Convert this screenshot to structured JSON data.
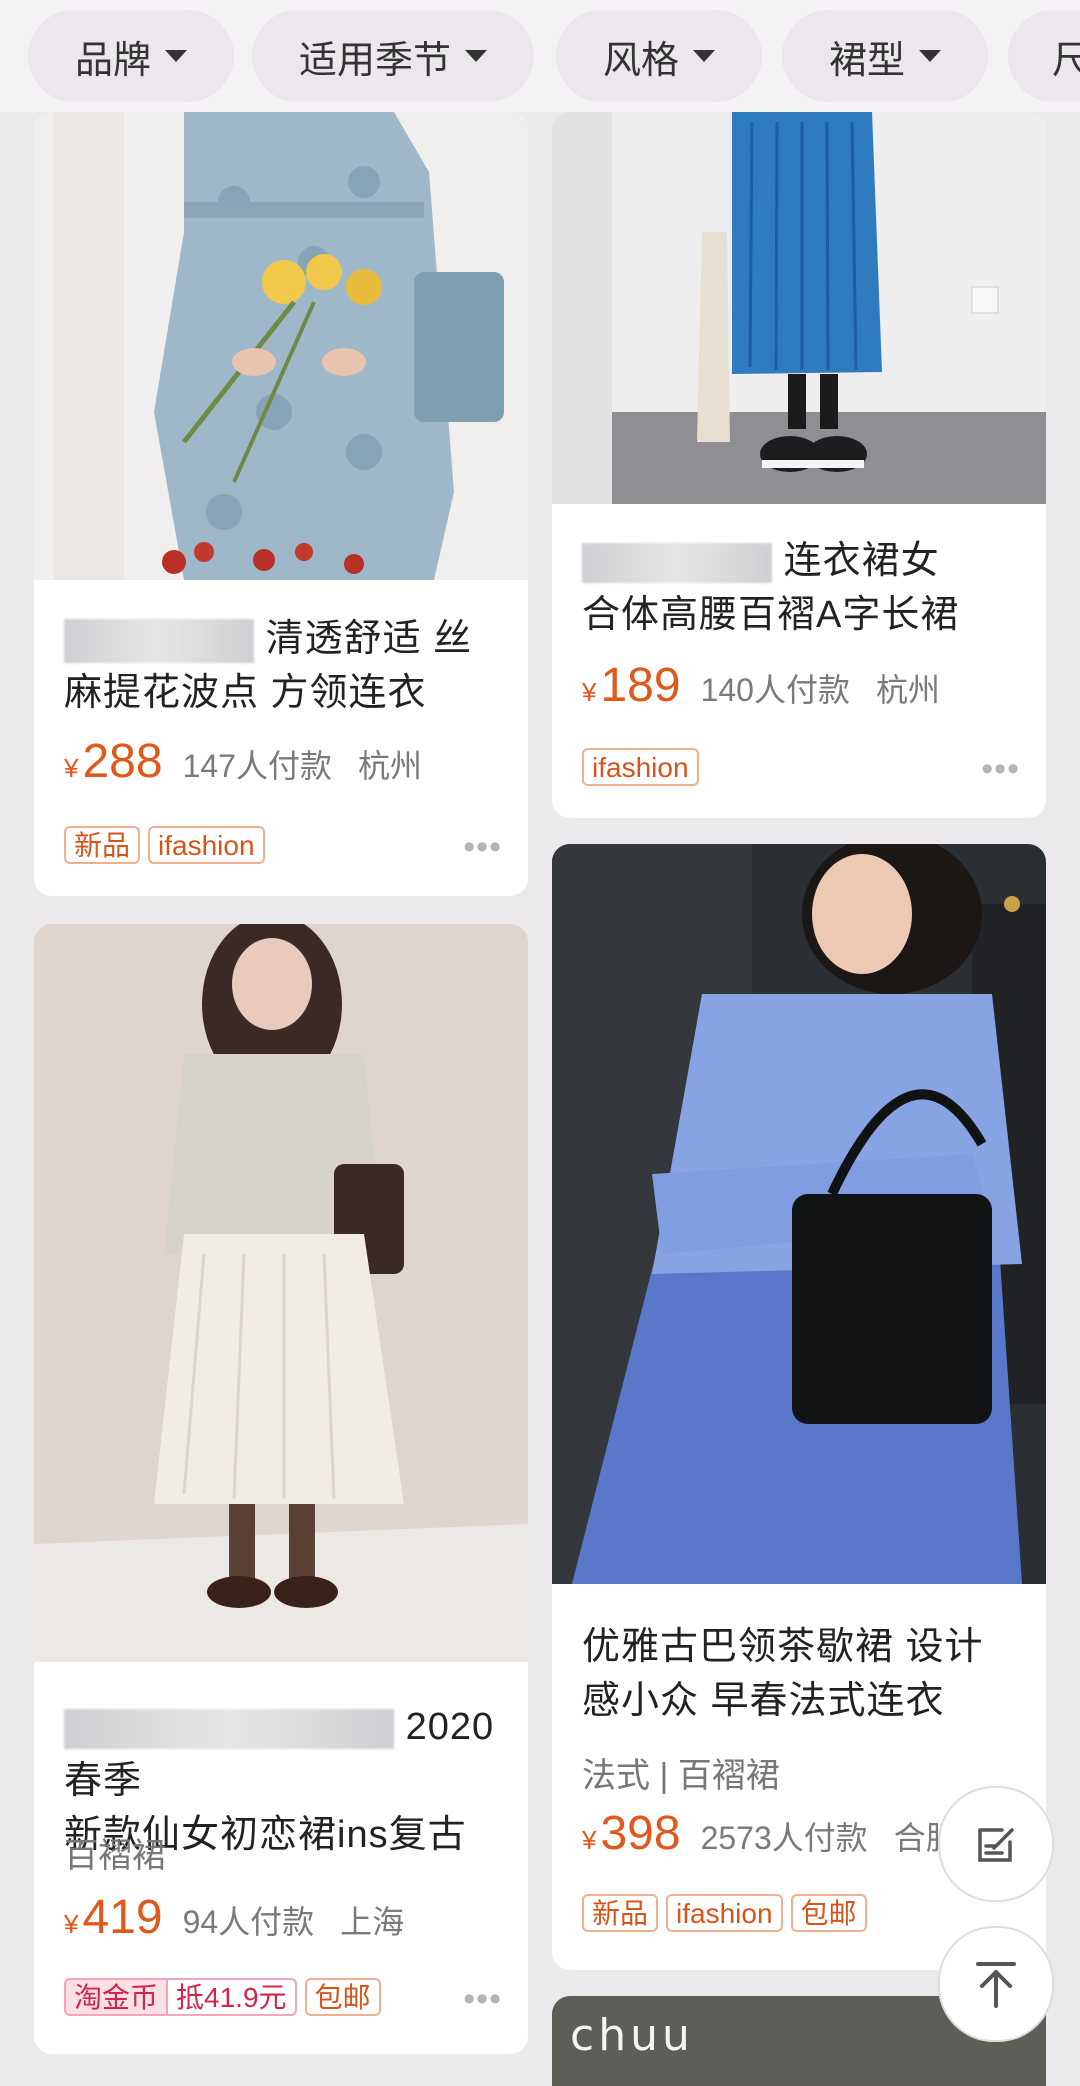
{
  "filters": [
    {
      "label": "品牌"
    },
    {
      "label": "适用季节"
    },
    {
      "label": "风格"
    },
    {
      "label": "裙型"
    },
    {
      "label": "尺"
    }
  ],
  "products": [
    {
      "title": "清透舒适 丝麻提花波点 方领连衣",
      "price_symbol": "¥",
      "price": "288",
      "sold": "147人付款",
      "location": "杭州",
      "tags": [
        "新品",
        "ifashion"
      ]
    },
    {
      "title_line1": "连衣裙女",
      "title_line2": "合体高腰百褶A字长裙",
      "price_symbol": "¥",
      "price": "189",
      "sold": "140人付款",
      "location": "杭州",
      "tags": [
        "ifashion"
      ]
    },
    {
      "title_line1": "2020春季",
      "title_line2": "新款仙女初恋裙ins复古",
      "subtitle": "百褶裙",
      "price_symbol": "¥",
      "price": "419",
      "sold": "94人付款",
      "location": "上海",
      "coin_label": "淘金币",
      "coin_value": "抵41.9元",
      "tags": [
        "包邮"
      ]
    },
    {
      "title": "优雅古巴领茶歇裙 设计感小众 早春法式连衣",
      "subtitle": "法式 | 百褶裙",
      "price_symbol": "¥",
      "price": "398",
      "sold": "2573人付款",
      "location": "合肥",
      "tags": [
        "新品",
        "ifashion",
        "包邮"
      ]
    },
    {
      "brand": "chuu"
    }
  ],
  "more_symbol": "•••",
  "icons": {
    "edit": "edit-icon",
    "back_to_top": "arrow-up-icon"
  }
}
